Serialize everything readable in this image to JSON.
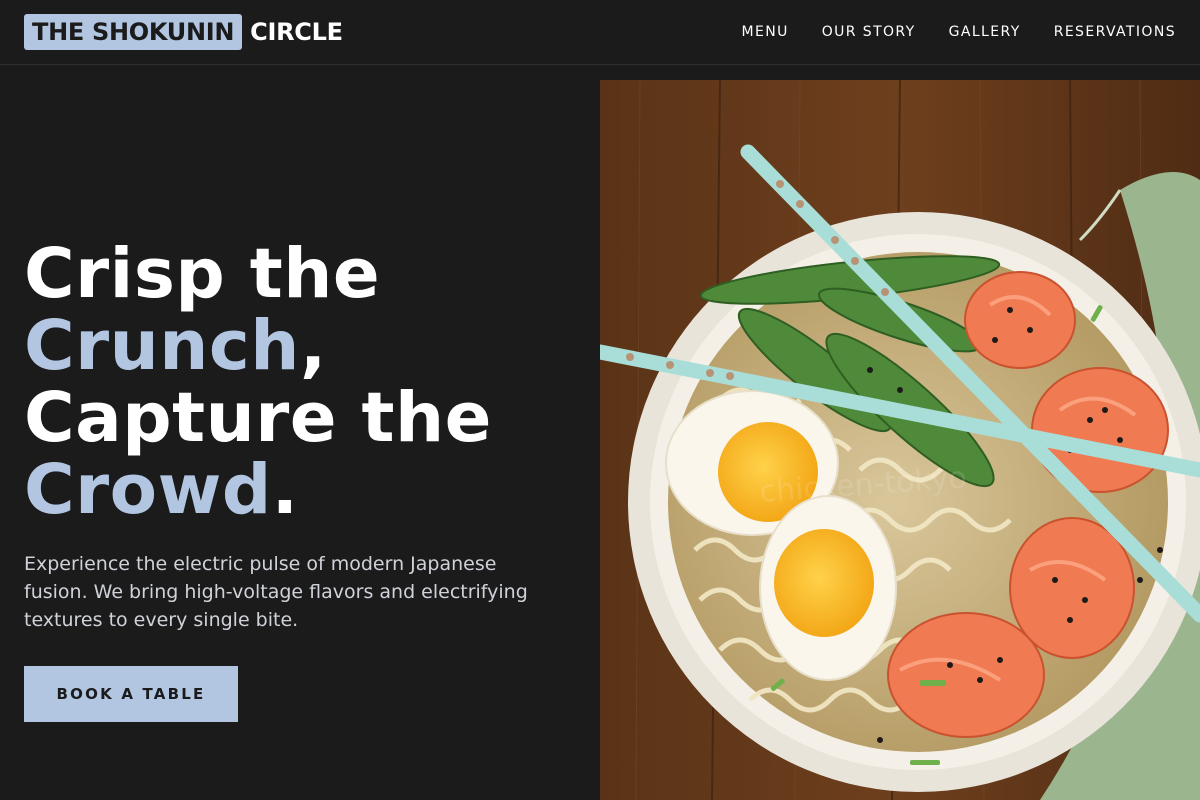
{
  "brand": {
    "highlight": "THE SHOKUNIN",
    "rest": "CIRCLE"
  },
  "nav": {
    "items": [
      "MENU",
      "OUR STORY",
      "GALLERY",
      "RESERVATIONS"
    ]
  },
  "hero": {
    "title": {
      "line1": "Crisp the",
      "line2_accent": "Crunch",
      "line2_punct": ",",
      "line3": "Capture the",
      "line4_accent": "Crowd",
      "line4_punct": "."
    },
    "description": "Experience the electric pulse of modern Japanese fusion. We bring high-voltage flavors and electrifying textures to every single bite.",
    "cta_label": "BOOK A TABLE"
  },
  "image": {
    "subject": "ramen-bowl-photo",
    "watermark": "chicken-tokyo"
  },
  "colors": {
    "background": "#1b1b1c",
    "accent": "#b2c6e2",
    "text": "#ffffff",
    "muted_text": "#cfd2d8"
  }
}
